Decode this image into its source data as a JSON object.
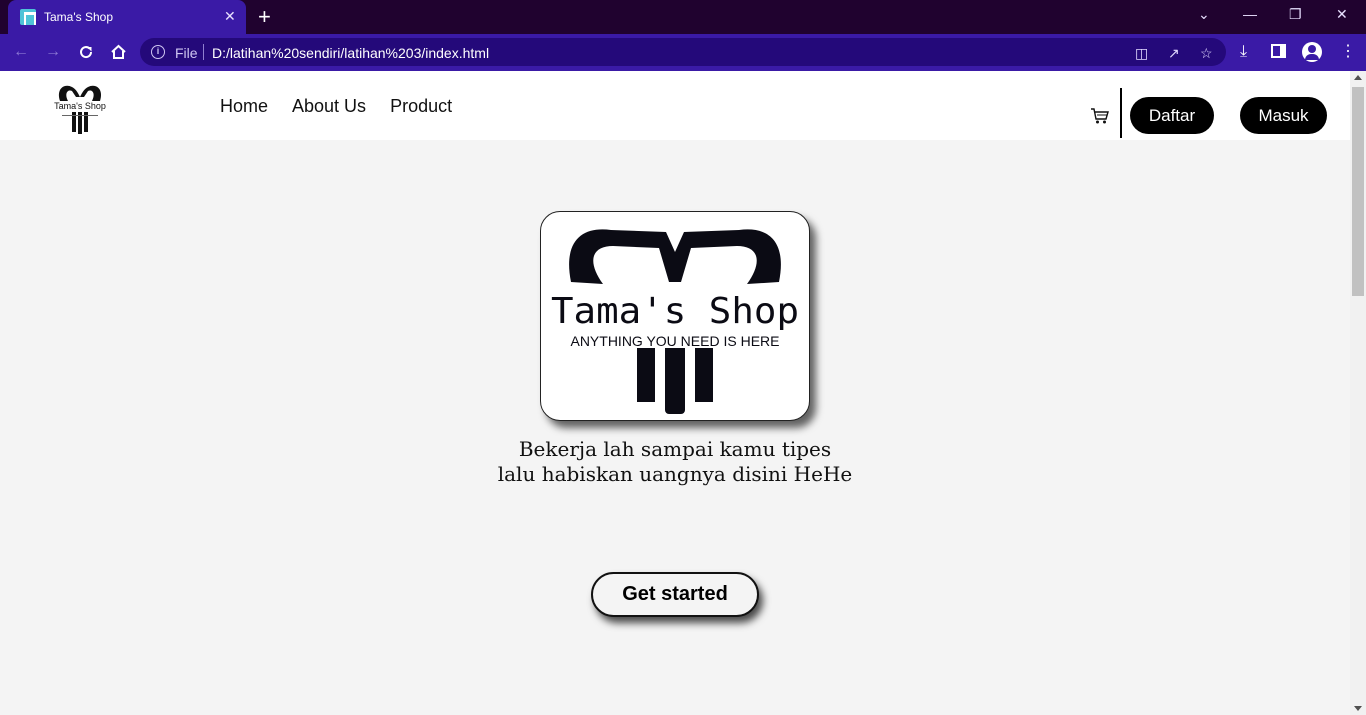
{
  "browser": {
    "tab_title": "Tama's Shop",
    "tab_close": "✕",
    "new_tab": "+",
    "file_label": "File",
    "url": "D:/latihan%20sendiri/latihan%203/index.html",
    "window_controls": {
      "dropdown": "⌄",
      "minimize": "—",
      "restore": "❐",
      "close": "✕"
    },
    "accent_color": "#3a1aa6"
  },
  "nav": {
    "logo_name": "Tama's Shop",
    "links": [
      "Home",
      "About Us",
      "Product"
    ],
    "cart_icon": "cart-icon",
    "register_label": "Daftar",
    "login_label": "Masuk"
  },
  "hero": {
    "logo_title": "Tama's Shop",
    "logo_subtitle": "ANYTHING YOU NEED IS HERE",
    "tagline_line1": "Bekerja lah sampai kamu tipes",
    "tagline_line2": "lalu habiskan uangnya disini HeHe",
    "cta_label": "Get started"
  }
}
